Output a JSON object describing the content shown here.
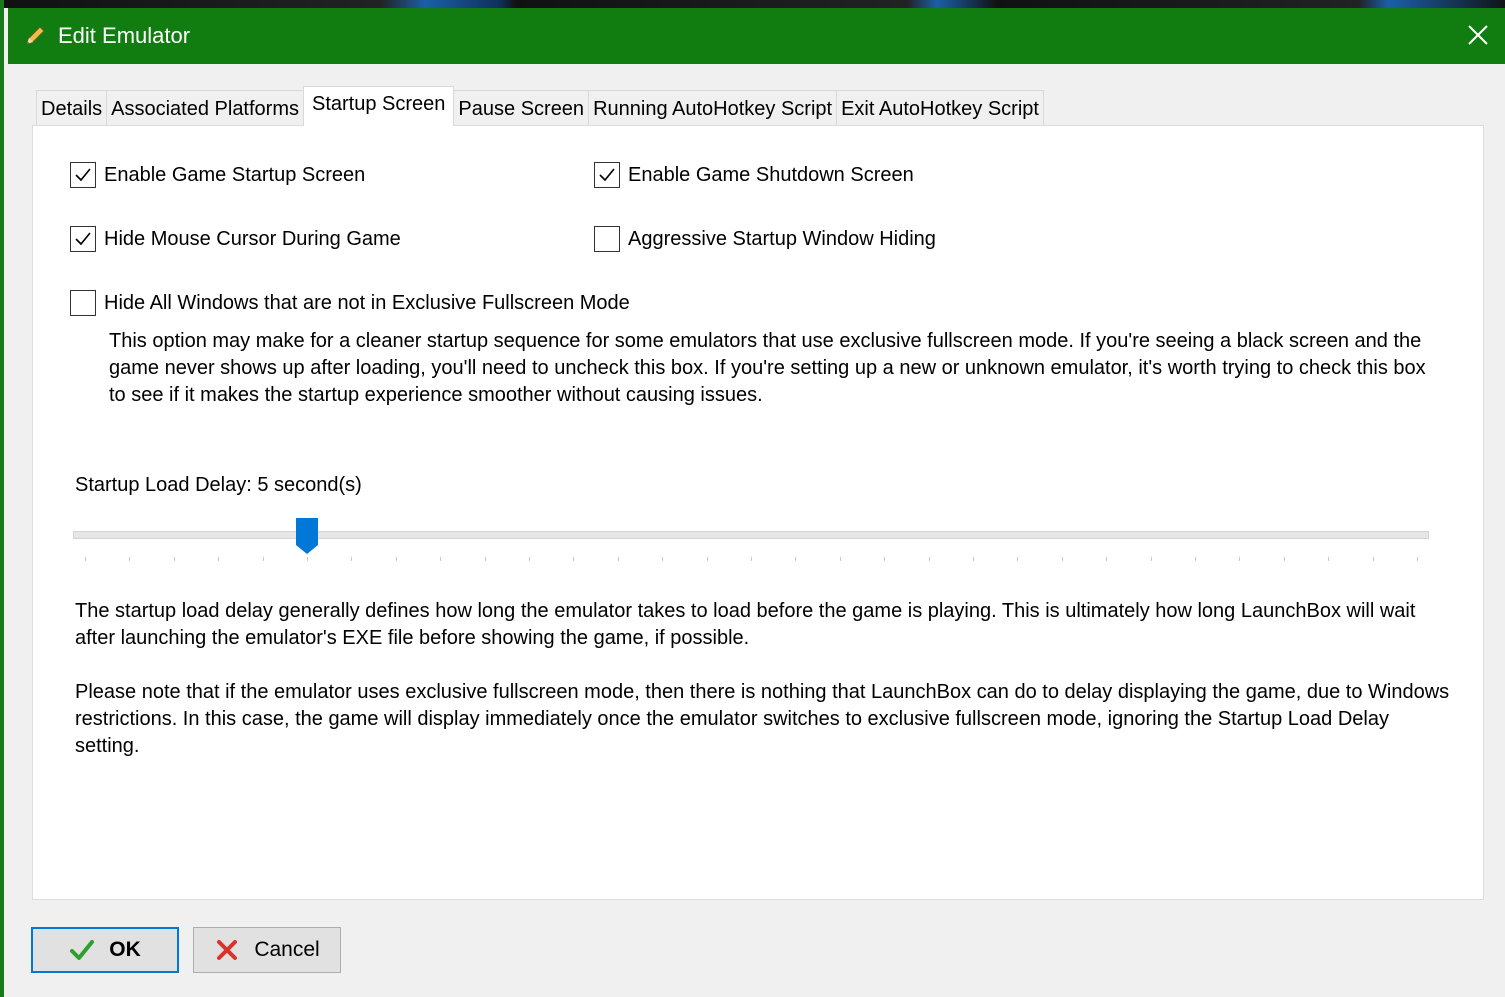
{
  "window": {
    "title": "Edit Emulator"
  },
  "tabs": [
    {
      "label": "Details",
      "active": false
    },
    {
      "label": "Associated Platforms",
      "active": false
    },
    {
      "label": "Startup Screen",
      "active": true
    },
    {
      "label": "Pause Screen",
      "active": false
    },
    {
      "label": "Running AutoHotkey Script",
      "active": false
    },
    {
      "label": "Exit AutoHotkey Script",
      "active": false
    }
  ],
  "options": {
    "enable_startup": {
      "label": "Enable Game Startup Screen",
      "checked": true
    },
    "enable_shutdown": {
      "label": "Enable Game Shutdown Screen",
      "checked": true
    },
    "hide_cursor": {
      "label": "Hide Mouse Cursor During Game",
      "checked": true
    },
    "aggressive_hiding": {
      "label": "Aggressive Startup Window Hiding",
      "checked": false
    },
    "hide_all_windows": {
      "label": "Hide All Windows that are not in Exclusive Fullscreen Mode",
      "checked": false
    }
  },
  "hide_all_windows_desc": "This option may make for a cleaner startup sequence for some emulators that use exclusive fullscreen mode. If you're seeing a black screen and the game never shows up after loading, you'll need to uncheck this box. If you're setting up a new or unknown emulator, it's worth trying to check this box to see if it makes the startup experience smoother without causing issues.",
  "slider": {
    "label": "Startup Load Delay: 5 second(s)",
    "value": 5,
    "min": 0,
    "max": 30
  },
  "delay_desc_1": "The startup load delay generally defines how long the emulator takes to load before the game is playing. This is ultimately how long LaunchBox will wait after launching the emulator's EXE file before showing the game, if possible.",
  "delay_desc_2": "Please note that if the emulator uses exclusive fullscreen mode, then there is nothing that LaunchBox can do to delay displaying the game, due to Windows restrictions. In this case, the game will display immediately once the emulator switches to exclusive fullscreen mode, ignoring the Startup Load Delay setting.",
  "buttons": {
    "ok_label": "OK",
    "cancel_label": "Cancel"
  },
  "colors": {
    "titlebar": "#117d11",
    "accent": "#0078d7",
    "ok_check": "#2e9e2e",
    "cancel_x": "#d9342b"
  },
  "icons": {
    "title": "pencil-icon",
    "close": "close-icon",
    "ok": "checkmark-icon",
    "cancel": "x-icon"
  }
}
